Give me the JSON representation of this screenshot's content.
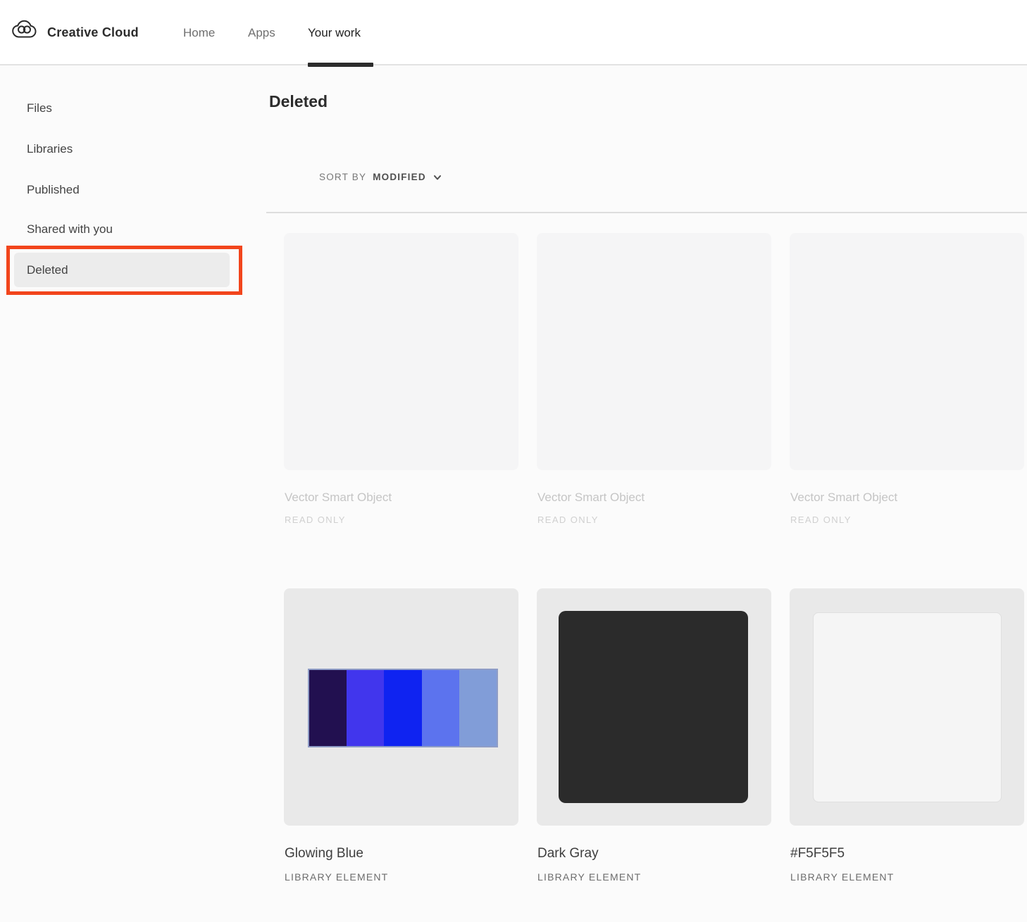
{
  "header": {
    "brand": "Creative Cloud",
    "nav": [
      {
        "label": "Home",
        "active": false
      },
      {
        "label": "Apps",
        "active": false
      },
      {
        "label": "Your work",
        "active": true
      }
    ]
  },
  "sidebar": {
    "items": [
      "Files",
      "Libraries",
      "Published",
      "Shared with you",
      "Deleted"
    ],
    "selected": "Deleted"
  },
  "annotation": {
    "shape": "rectangle",
    "color": "#F2451C",
    "target": "Deleted sidebar item"
  },
  "main": {
    "title": "Deleted",
    "sort": {
      "label": "SORT BY",
      "value": "MODIFIED"
    },
    "cards": [
      {
        "name": "Vector Smart Object",
        "meta": "READ ONLY",
        "kind": "empty-faded"
      },
      {
        "name": "Vector Smart Object",
        "meta": "READ ONLY",
        "kind": "empty-faded"
      },
      {
        "name": "Vector Smart Object",
        "meta": "READ ONLY",
        "kind": "empty-faded"
      },
      {
        "name": "Glowing Blue",
        "meta": "LIBRARY ELEMENT",
        "kind": "palette",
        "palette": [
          "#221050",
          "#4136ED",
          "#0F23F1",
          "#5C73EE",
          "#819DD8"
        ]
      },
      {
        "name": "Dark Gray",
        "meta": "LIBRARY ELEMENT",
        "kind": "color-swatch",
        "swatch": "#2B2B2B"
      },
      {
        "name": "#F5F5F5",
        "meta": "LIBRARY ELEMENT",
        "kind": "color-swatch",
        "swatch": "#F5F5F5"
      }
    ]
  }
}
